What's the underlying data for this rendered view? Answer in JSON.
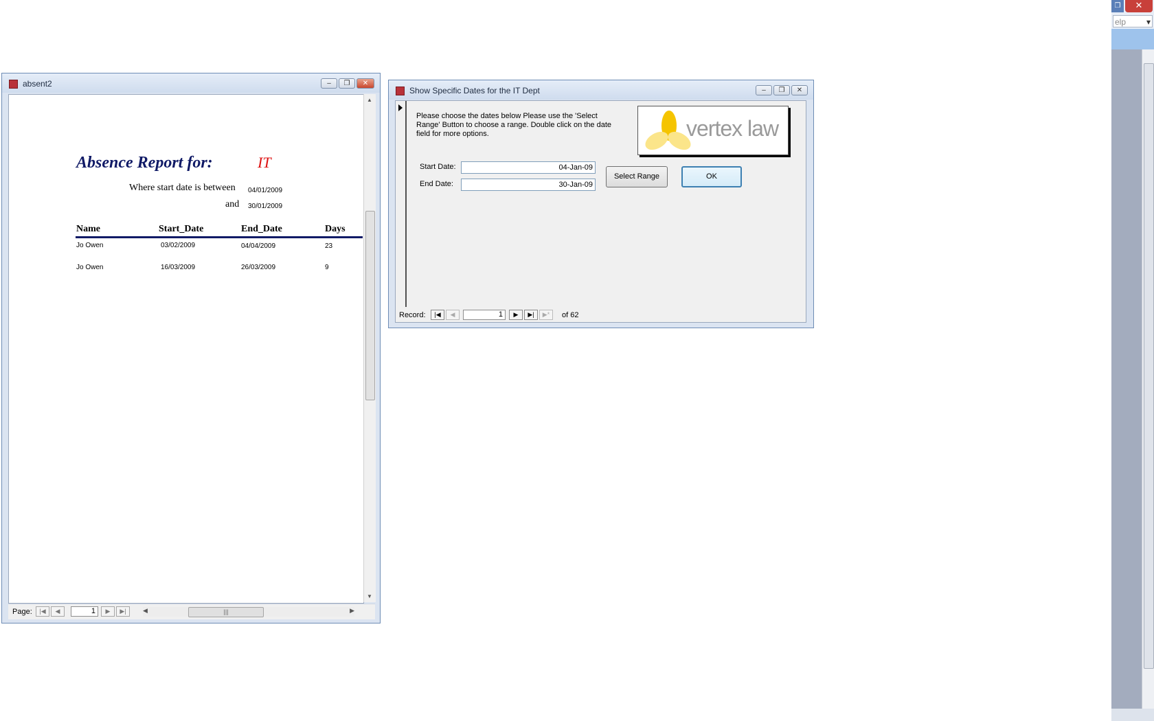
{
  "app_frame": {
    "close_glyph": "✕",
    "restore_glyph": "❐",
    "help_partial": "elp",
    "help_dropdown_glyph": "▾"
  },
  "report_window": {
    "title": "absent2",
    "report_title": "Absence Report for:",
    "department": "IT",
    "where_text": "Where start date is between",
    "and_text": "and",
    "date_from": "04/01/2009",
    "date_to": "30/01/2009",
    "columns": [
      "Name",
      "Start_Date",
      "End_Date",
      "Days"
    ],
    "rows": [
      [
        "Jo Owen",
        "03/02/2009",
        "04/04/2009",
        "23"
      ],
      [
        "Jo Owen",
        "16/03/2009",
        "26/03/2009",
        "9"
      ]
    ],
    "page_label": "Page:",
    "page_value": "1"
  },
  "form_window": {
    "title": "Show Specific Dates for the IT Dept",
    "instructions": "Please choose the dates below Please use the 'Select Range' Button to choose a range. Double click on the date field for more options.",
    "logo_text": "vertex law",
    "start_label": "Start Date:",
    "start_value": "04-Jan-09",
    "end_label": "End Date:",
    "end_value": "30-Jan-09",
    "select_range_label": "Select Range",
    "ok_label": "OK",
    "record_label": "Record:",
    "record_value": "1",
    "record_of": "of  62"
  },
  "colors": {
    "title_blue": "#101a66",
    "dept_red": "#dd1111",
    "logo_yellow": "#f5c400"
  }
}
